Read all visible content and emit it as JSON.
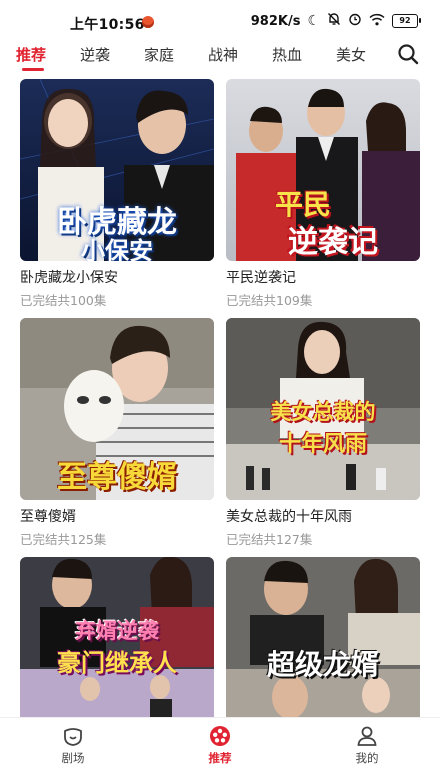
{
  "status_bar": {
    "time": "上午10:56",
    "net_speed": "982K/s",
    "battery": "92"
  },
  "tabs": [
    {
      "label": "推荐",
      "active": true
    },
    {
      "label": "逆袭",
      "active": false
    },
    {
      "label": "家庭",
      "active": false
    },
    {
      "label": "战神",
      "active": false
    },
    {
      "label": "热血",
      "active": false
    },
    {
      "label": "美女",
      "active": false
    }
  ],
  "dramas": [
    {
      "poster_text": "卧虎藏龙",
      "poster_sub": "小保安",
      "title": "卧虎藏龙小保安",
      "status": "已完结共100集"
    },
    {
      "poster_text": "平民",
      "poster_sub": "逆袭记",
      "title": "平民逆袭记",
      "status": "已完结共109集"
    },
    {
      "poster_text": "至尊傻婿",
      "title": "至尊傻婿",
      "status": "已完结共125集"
    },
    {
      "poster_text": "美女总裁的",
      "poster_sub": "十年风雨",
      "title": "美女总裁的十年风雨",
      "status": "已完结共127集"
    },
    {
      "poster_text": "弃婿逆袭",
      "poster_sub": "豪门继承人"
    },
    {
      "poster_text": "超级龙婿"
    }
  ],
  "bottom_nav": [
    {
      "label": "剧场",
      "icon": "theater-icon",
      "active": false
    },
    {
      "label": "推荐",
      "icon": "film-reel-icon",
      "active": true
    },
    {
      "label": "我的",
      "icon": "user-icon",
      "active": false
    }
  ],
  "colors": {
    "accent": "#e02431"
  }
}
